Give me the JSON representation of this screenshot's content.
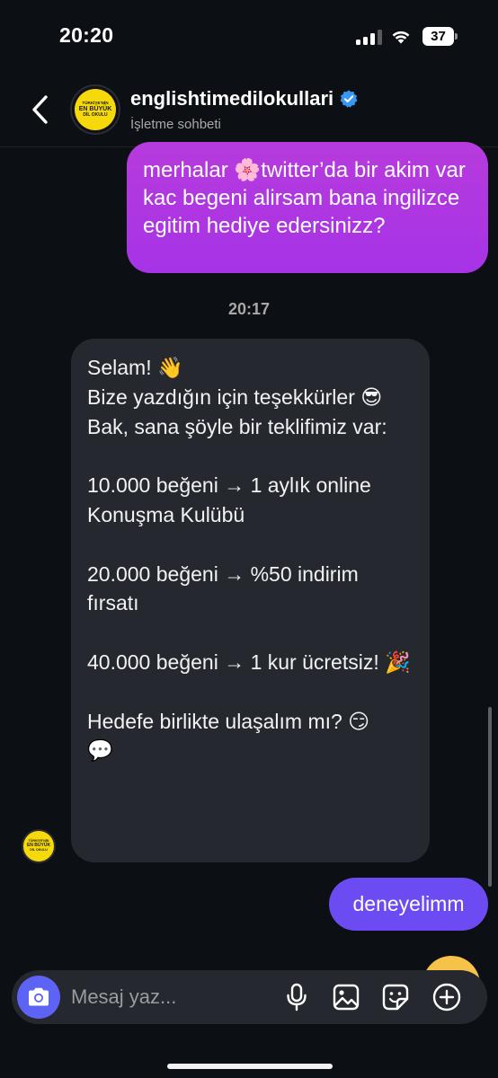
{
  "status_bar": {
    "time": "20:20",
    "battery": "37"
  },
  "header": {
    "name": "englishtimedilokullari",
    "subtitle": "İşletme sohbeti",
    "avatar_text": [
      "TÜRKİYE'NİN",
      "EN BÜYÜK",
      "DİL OKULU"
    ]
  },
  "messages": [
    {
      "from": "me",
      "text": "merhalar 🌸twitter’da bir akim var kac begeni alirsam bana ingilizce egitim hediye edersinizz?"
    },
    {
      "type": "timestamp",
      "text": "20:17"
    },
    {
      "from": "business",
      "text": "Selam! 👋\nBize yazdığın için teşekkürler 😎\nBak, sana şöyle bir teklifimiz var:\n\n10.000 beğeni → 1 aylık online Konuşma Kulübü\n\n20.000 beğeni → %50 indirim fırsatı\n\n40.000 beğeni → 1 kur ücretsiz! 🎉\n\nHedefe birlikte ulaşalım mı? 😏\n💬"
    },
    {
      "from": "me",
      "text": "deneyelimm"
    }
  ],
  "composer": {
    "placeholder": "Mesaj yaz..."
  },
  "icons": {
    "back": "chevron-left-icon",
    "verified": "verified-badge-icon",
    "camera": "camera-icon",
    "mic": "microphone-icon",
    "gallery": "image-icon",
    "sticker": "sticker-icon",
    "more": "plus-circle-icon"
  },
  "colors": {
    "background": "#0c0f14",
    "outgoing_bubble": "#b73bdc",
    "incoming_bubble": "#25282e",
    "short_outgoing_bubble": "#6c4cf2",
    "camera_button": "#5d63f5",
    "verified": "#3897f0",
    "avatar_yellow": "#f5d90a"
  }
}
